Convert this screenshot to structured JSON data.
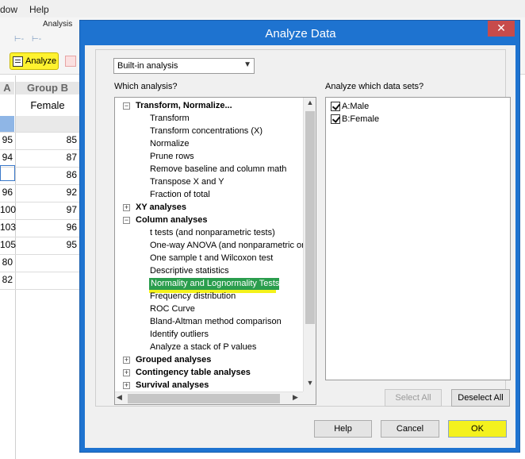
{
  "app": {
    "menu": [
      "dow",
      "Help"
    ],
    "ribbon_group_label": "Analysis",
    "analyze_label": "Analyze",
    "columns": {
      "a_header": "A",
      "b_header": "Group B",
      "b_title": "Female"
    },
    "col_a_values": [
      "95",
      "94",
      "",
      "96",
      "100",
      "103",
      "105",
      "80",
      "82"
    ],
    "col_b_values": [
      "85",
      "87",
      "86",
      "92",
      "97",
      "96",
      "95"
    ]
  },
  "dialog": {
    "title": "Analyze Data",
    "close_glyph": "✕",
    "analysis_type": "Built-in analysis",
    "which_analysis_label": "Which analysis?",
    "datasets_label": "Analyze which data sets?",
    "tree": [
      {
        "kind": "cat",
        "toggle": "−",
        "label": "Transform, Normalize..."
      },
      {
        "kind": "leaf",
        "label": "Transform"
      },
      {
        "kind": "leaf",
        "label": "Transform concentrations (X)"
      },
      {
        "kind": "leaf",
        "label": "Normalize"
      },
      {
        "kind": "leaf",
        "label": "Prune rows"
      },
      {
        "kind": "leaf",
        "label": "Remove baseline and column math"
      },
      {
        "kind": "leaf",
        "label": "Transpose X and Y"
      },
      {
        "kind": "leaf",
        "label": "Fraction of total"
      },
      {
        "kind": "cat",
        "toggle": "+",
        "label": "XY analyses"
      },
      {
        "kind": "cat",
        "toggle": "−",
        "label": "Column analyses"
      },
      {
        "kind": "leaf",
        "label": "t tests (and nonparametric tests)"
      },
      {
        "kind": "leaf",
        "label": "One-way ANOVA (and nonparametric or"
      },
      {
        "kind": "leaf",
        "label": "One sample t and Wilcoxon test"
      },
      {
        "kind": "leaf",
        "label": "Descriptive statistics"
      },
      {
        "kind": "leaf",
        "label": "Normality and Lognormality Tests",
        "selected": true
      },
      {
        "kind": "leaf",
        "label": "Frequency distribution"
      },
      {
        "kind": "leaf",
        "label": "ROC Curve"
      },
      {
        "kind": "leaf",
        "label": "Bland-Altman method comparison"
      },
      {
        "kind": "leaf",
        "label": "Identify outliers"
      },
      {
        "kind": "leaf",
        "label": "Analyze a stack of P values"
      },
      {
        "kind": "cat",
        "toggle": "+",
        "label": "Grouped analyses"
      },
      {
        "kind": "cat",
        "toggle": "+",
        "label": "Contingency table analyses"
      },
      {
        "kind": "cat",
        "toggle": "+",
        "label": "Survival analyses"
      }
    ],
    "datasets": [
      {
        "label": "A:Male",
        "checked": true
      },
      {
        "label": "B:Female",
        "checked": true
      }
    ],
    "buttons": {
      "select_all": "Select All",
      "deselect_all": "Deselect All",
      "help": "Help",
      "cancel": "Cancel",
      "ok": "OK"
    },
    "colors": {
      "title_bar": "#1e73d0",
      "selection": "#2a9d4d",
      "marker": "#f4f11e"
    }
  }
}
